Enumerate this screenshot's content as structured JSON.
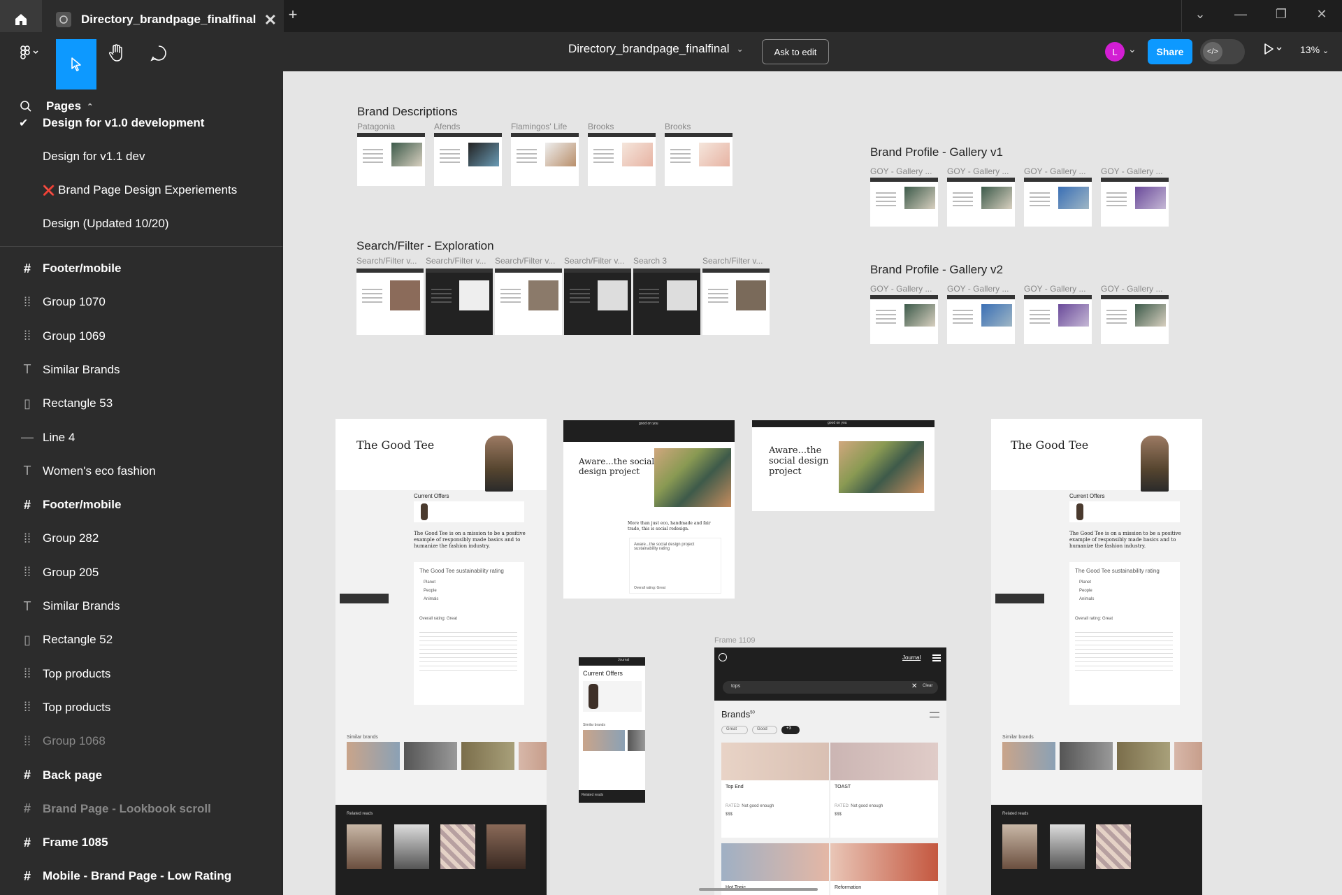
{
  "window": {
    "file_tab_title": "Directory_brandpage_finalfinal",
    "close_symbol": "✕",
    "new_tab_symbol": "+",
    "controls": [
      "⌄",
      "—",
      "❐",
      "✕"
    ]
  },
  "toolbar": {
    "doc_title": "Directory_brandpage_finalfinal",
    "ask_to_edit": "Ask to edit",
    "avatar_initial": "L",
    "share": "Share",
    "zoom": "13%",
    "dev_mode_symbol": "</>"
  },
  "pages": {
    "header": "Pages",
    "items": [
      {
        "label": "Design for v1.0 development",
        "selected": true
      },
      {
        "label": "Design for v1.1 dev",
        "selected": false
      },
      {
        "label": "Brand Page Design Experiements",
        "selected": false,
        "prefix": "❌"
      },
      {
        "label": "Design (Updated 10/20)",
        "selected": false
      }
    ]
  },
  "layers": [
    {
      "icon": "#",
      "label": "Footer/mobile",
      "kind": "frame"
    },
    {
      "icon": "⁞⁞",
      "label": "Group 1070",
      "kind": "group"
    },
    {
      "icon": "⁞⁞",
      "label": "Group 1069",
      "kind": "group"
    },
    {
      "icon": "T",
      "label": "Similar Brands",
      "kind": "text"
    },
    {
      "icon": "▯",
      "label": "Rectangle 53",
      "kind": "rect"
    },
    {
      "icon": "—",
      "label": "Line 4",
      "kind": "line"
    },
    {
      "icon": "T",
      "label": "Women's eco fashion",
      "kind": "text"
    },
    {
      "icon": "#",
      "label": "Footer/mobile",
      "kind": "frame"
    },
    {
      "icon": "⁞⁞",
      "label": "Group 282",
      "kind": "group"
    },
    {
      "icon": "⁞⁞",
      "label": "Group 205",
      "kind": "group"
    },
    {
      "icon": "T",
      "label": "Similar Brands",
      "kind": "text"
    },
    {
      "icon": "▯",
      "label": "Rectangle 52",
      "kind": "rect"
    },
    {
      "icon": "⁞⁞",
      "label": "Top products",
      "kind": "group"
    },
    {
      "icon": "⁞⁞",
      "label": "Top products",
      "kind": "group"
    },
    {
      "icon": "⁞⁞",
      "label": "Group 1068",
      "kind": "group-dim"
    },
    {
      "icon": "#",
      "label": "Back page",
      "kind": "frame"
    },
    {
      "icon": "#",
      "label": "Brand Page - Lookbook scroll",
      "kind": "frame-dim"
    },
    {
      "icon": "#",
      "label": "Frame 1085",
      "kind": "frame"
    },
    {
      "icon": "#",
      "label": "Mobile - Brand Page - Low Rating",
      "kind": "frame"
    }
  ],
  "canvas": {
    "brand_descriptions": {
      "title": "Brand Descriptions",
      "thumbs": [
        "Patagonia",
        "Afends",
        "Flamingos' Life",
        "Brooks",
        "Brooks"
      ]
    },
    "search_filter": {
      "title": "Search/Filter - Exploration",
      "thumbs": [
        "Search/Filter v...",
        "Search/Filter v...",
        "Search/Filter v...",
        "Search/Filter v...",
        "Search 3",
        "Search/Filter v..."
      ]
    },
    "gallery_v1": {
      "title": "Brand Profile - Gallery v1",
      "thumbs": [
        "GOY - Gallery ...",
        "GOY - Gallery ...",
        "GOY - Gallery ...",
        "GOY - Gallery ..."
      ]
    },
    "gallery_v2": {
      "title": "Brand Profile - Gallery v2",
      "thumbs": [
        "GOY - Gallery ...",
        "GOY - Gallery ...",
        "GOY - Gallery ...",
        "GOY - Gallery ..."
      ]
    },
    "good_tee": {
      "brand": "The Good Tee",
      "current_offers": "Current Offers",
      "mission": "The Good Tee is on a mission to be a positive example of responsibly made basics and to humanize the fashion industry.",
      "rating_title": "The Good Tee sustainability rating",
      "rating_rows": [
        "Planet",
        "People",
        "Animals"
      ],
      "overall": "Overall rating: Great",
      "similar": "Similar brands",
      "related": "Related reads"
    },
    "aware": {
      "brand": "Aware...the social design project",
      "brand_short": "Aware...the social design project",
      "logo": "good on you",
      "blurb": "More than just eco, handmade and fair trade, this is social redesign.",
      "rating_title": "Aware...the social design project sustainability rating",
      "overall": "Overall rating: Great"
    },
    "mobile_offers": {
      "title": "Current Offers",
      "similar": "Similar brands",
      "related": "Related reads",
      "journal": "Journal"
    },
    "frame_1109": {
      "label": "Frame 1109",
      "journal": "Journal",
      "search_value": "tops",
      "clear": "Clear",
      "brands_heading": "Brands",
      "brands_count": "50",
      "chips": [
        "Great",
        "Good",
        "+3"
      ],
      "cards": [
        {
          "name": "Top End",
          "rating": "Not good enough",
          "price": "$$$"
        },
        {
          "name": "TOAST",
          "rating": "Not good enough",
          "price": "$$$"
        },
        {
          "name": "Hot Topic",
          "rating": "",
          "price": ""
        },
        {
          "name": "Reformation",
          "rating": "",
          "price": ""
        }
      ],
      "rated_label": "RATED:"
    }
  }
}
